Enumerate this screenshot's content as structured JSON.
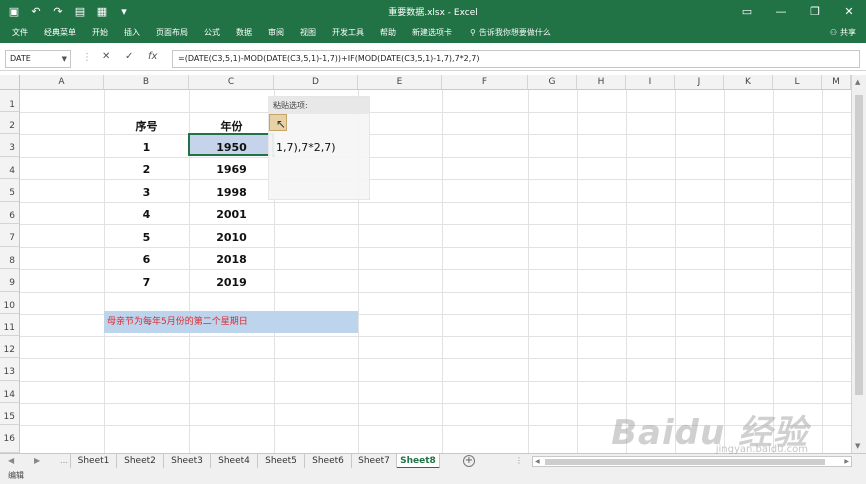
{
  "window": {
    "title": "重要数据.xlsx - Excel"
  },
  "qat": {
    "save_icon": "save-icon",
    "undo_icon": "undo-icon",
    "redo_icon": "redo-icon",
    "print_icon": "print-icon",
    "form_icon": "form-icon"
  },
  "menu": {
    "items": [
      "文件",
      "经典菜单",
      "开始",
      "插入",
      "页面布局",
      "公式",
      "数据",
      "审阅",
      "视图",
      "开发工具",
      "帮助",
      "新建选项卡"
    ],
    "tellme": "告诉我你想要做什么",
    "share": "共享"
  },
  "formula_bar": {
    "name_box": "DATE",
    "formula": "=(DATE(C3,5,1)-MOD(DATE(C3,5,1)-1,7))+IF(MOD(DATE(C3,5,1)-1,7),7*2,7)"
  },
  "columns": [
    "A",
    "B",
    "C",
    "D",
    "E",
    "F",
    "G",
    "H",
    "I",
    "J",
    "K",
    "L",
    "M"
  ],
  "rows": [
    "1",
    "2",
    "3",
    "4",
    "5",
    "6",
    "7",
    "8",
    "9",
    "10",
    "11",
    "12",
    "13",
    "14",
    "15",
    "16"
  ],
  "table": {
    "headers": {
      "index": "序号",
      "year": "年份"
    },
    "rows": [
      {
        "index": "1",
        "year": "1950"
      },
      {
        "index": "2",
        "year": "1969"
      },
      {
        "index": "3",
        "year": "1998"
      },
      {
        "index": "4",
        "year": "2001"
      },
      {
        "index": "5",
        "year": "2010"
      },
      {
        "index": "6",
        "year": "2018"
      },
      {
        "index": "7",
        "year": "2019"
      }
    ]
  },
  "overflow_text": "1,7),7*2,7)",
  "note": "母亲节为每年5月份的第二个星期日",
  "paste_popup": {
    "label": "粘贴选项:"
  },
  "sheets": [
    "Sheet1",
    "Sheet2",
    "Sheet3",
    "Sheet4",
    "Sheet5",
    "Sheet6",
    "Sheet7",
    "Sheet8"
  ],
  "active_sheet": "Sheet8",
  "status": {
    "mode": "编辑"
  },
  "watermark": {
    "brand": "Baidu 经验",
    "url": "jingyan.baidu.com"
  },
  "colors": {
    "excel_green": "#217346",
    "selection_fill": "#c5d4ea",
    "note_fill": "#bcd4ec",
    "note_text": "#e0282f"
  }
}
